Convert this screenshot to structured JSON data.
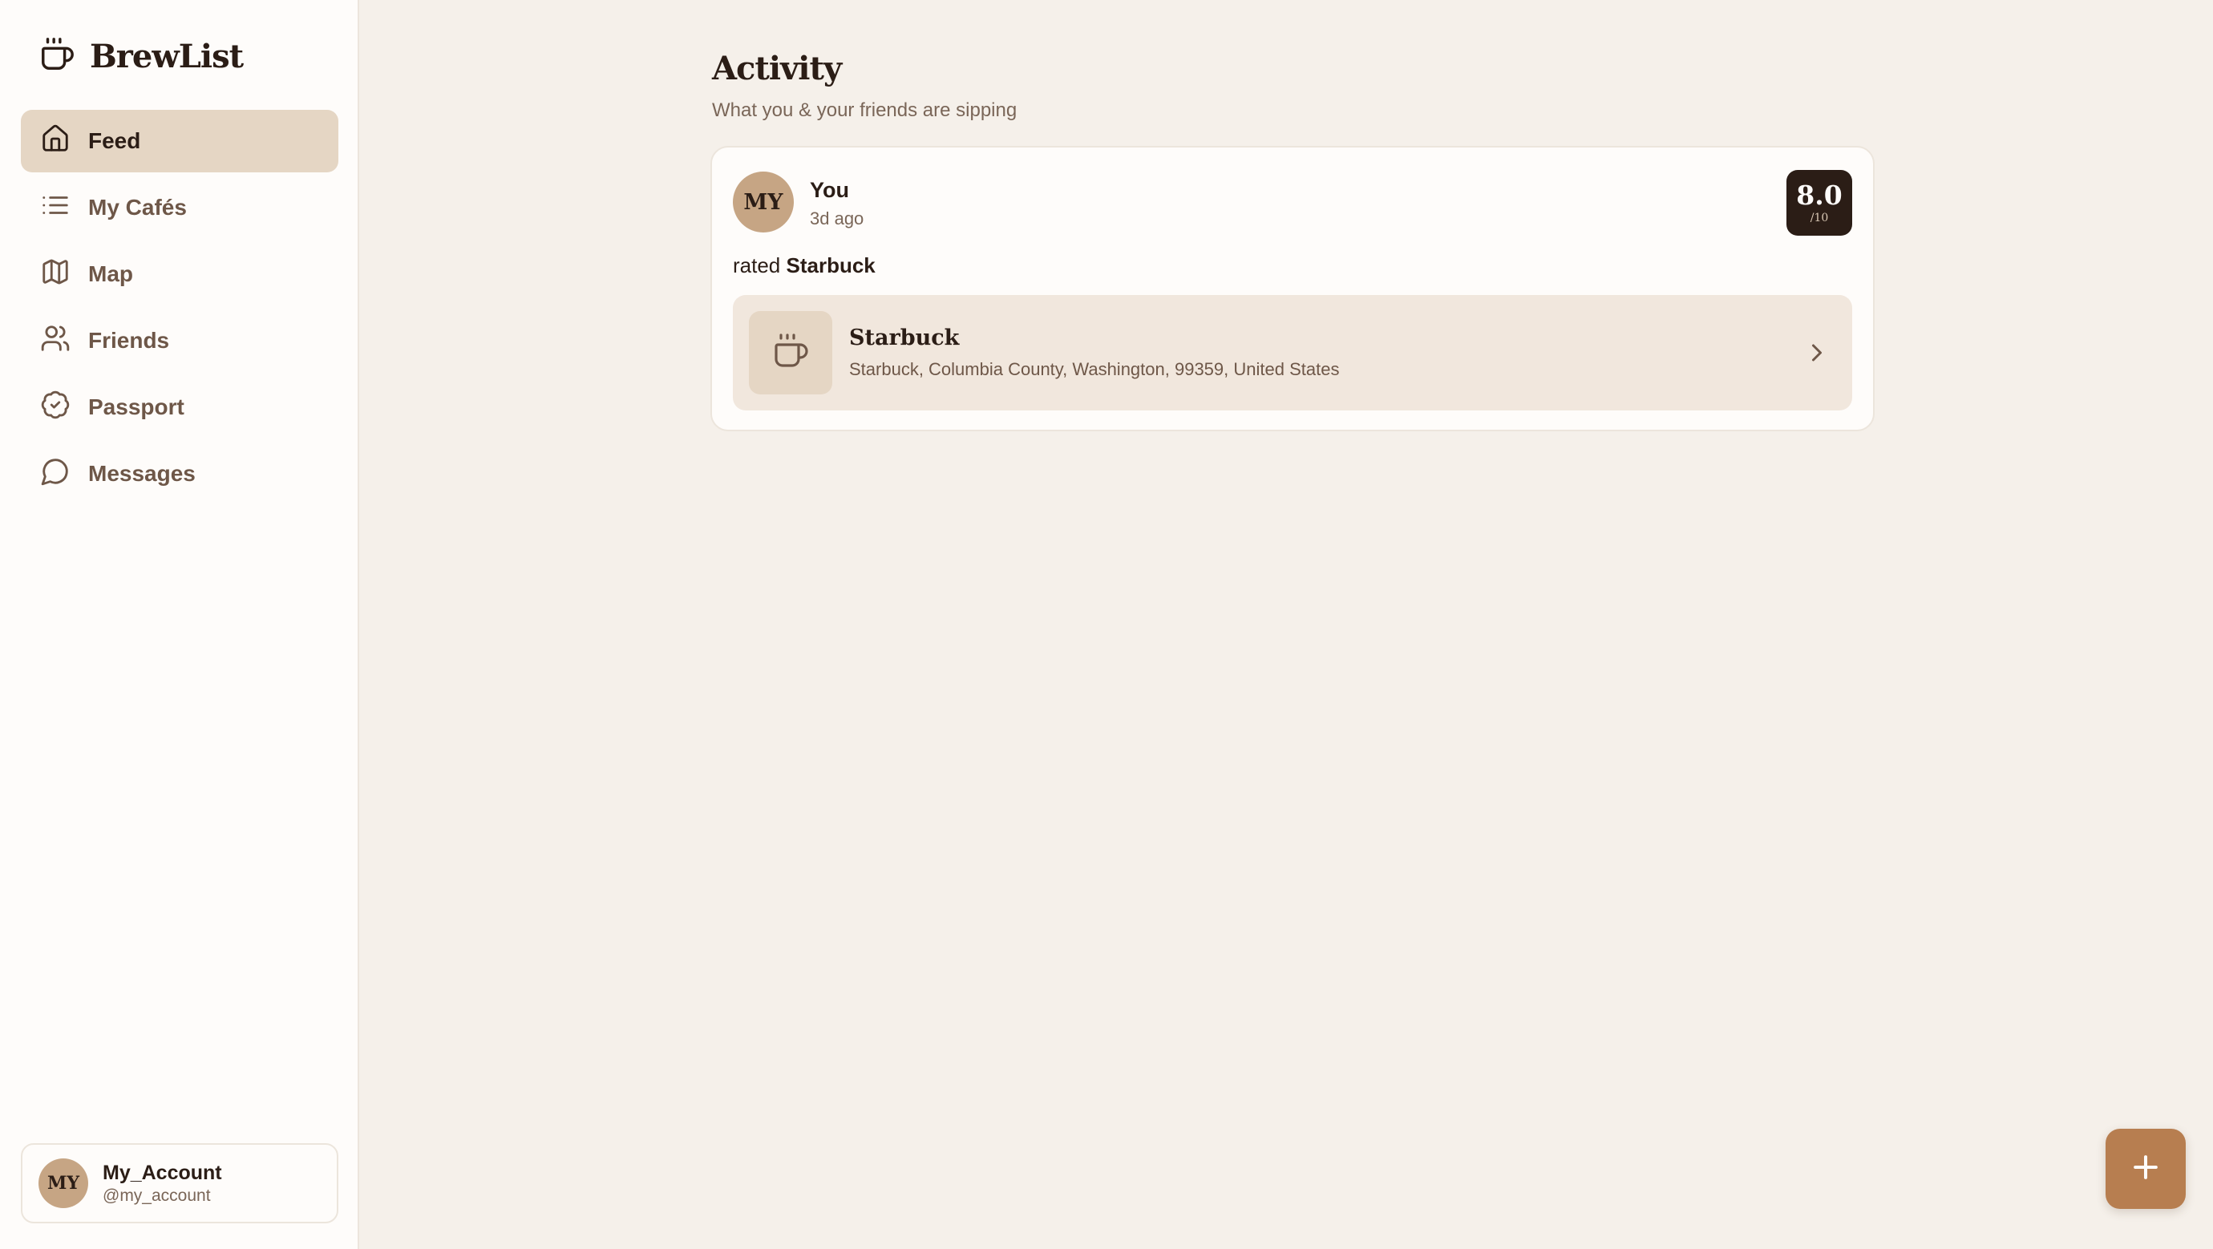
{
  "brand": {
    "name": "BrewList",
    "icon": "coffee-cup-icon"
  },
  "nav": {
    "items": [
      {
        "label": "Feed",
        "icon": "home-icon",
        "active": true
      },
      {
        "label": "My Cafés",
        "icon": "list-icon",
        "active": false
      },
      {
        "label": "Map",
        "icon": "map-icon",
        "active": false
      },
      {
        "label": "Friends",
        "icon": "users-icon",
        "active": false
      },
      {
        "label": "Passport",
        "icon": "badge-check-icon",
        "active": false
      },
      {
        "label": "Messages",
        "icon": "message-circle-icon",
        "active": false
      }
    ]
  },
  "account": {
    "initials": "MY",
    "name": "My_Account",
    "handle": "@my_account"
  },
  "main": {
    "title": "Activity",
    "subtitle": "What you & your friends are sipping"
  },
  "feed": {
    "items": [
      {
        "avatar_initials": "MY",
        "user": "You",
        "time": "3d ago",
        "score": "8.0",
        "score_scale": "/10",
        "action_prefix": "rated",
        "action_target": "Starbuck",
        "cafe": {
          "name": "Starbuck",
          "address": "Starbuck, Columbia County, Washington, 99359, United States",
          "icon": "coffee-cup-icon"
        }
      }
    ]
  },
  "fab": {
    "icon": "plus-icon"
  },
  "colors": {
    "background": "#f5f0ea",
    "sidebar": "#fefcfa",
    "active_nav": "#e5d6c4",
    "accent": "#b77e50",
    "dark": "#2b1d16",
    "avatar": "#c6a584"
  }
}
